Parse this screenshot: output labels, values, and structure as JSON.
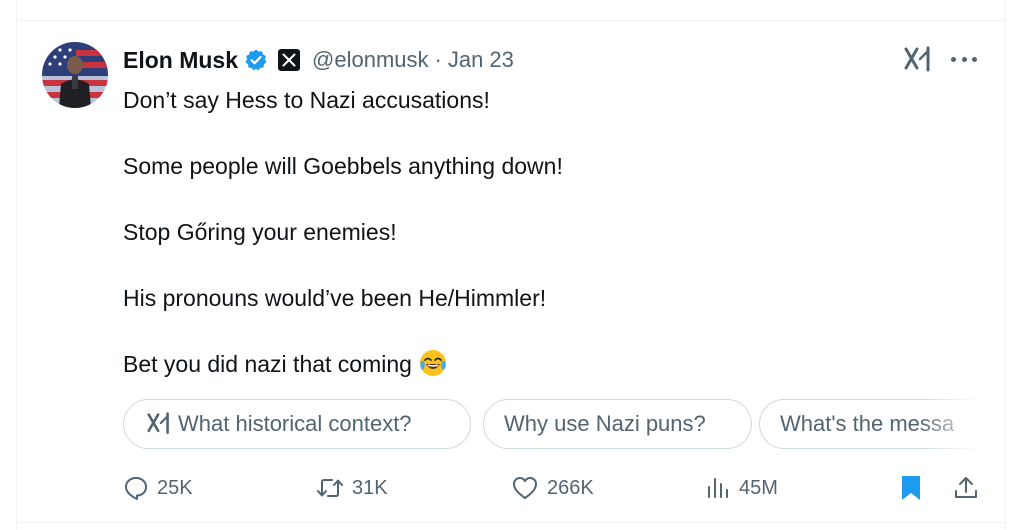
{
  "tweet": {
    "author_name": "Elon Musk",
    "handle": "@elonmusk",
    "separator": "·",
    "date": "Jan 23",
    "lines": [
      "Don’t say Hess to Nazi accusations!",
      "Some people will Goebbels anything down!",
      "Stop Gőring your enemies!",
      "His pronouns would’ve been He/Himmler!",
      "Bet you did nazi that coming"
    ],
    "emoji": "face-with-tears-of-joy"
  },
  "grok_suggestions": [
    "What historical context?",
    "Why use Nazi puns?",
    "What's the messa"
  ],
  "actions": {
    "replies": "25K",
    "reposts": "31K",
    "likes": "266K",
    "views": "45M"
  },
  "icons": {
    "verified": "verified-badge-icon",
    "affiliate": "x-logo-icon",
    "grok": "grok-icon",
    "more": "more-icon",
    "reply": "reply-icon",
    "repost": "repost-icon",
    "like": "heart-icon",
    "views": "views-icon",
    "bookmark": "bookmark-icon",
    "share": "share-icon"
  },
  "colors": {
    "text": "#0f1419",
    "secondary": "#536471",
    "verified": "#1d9bf0",
    "bookmark": "#1d9bf0",
    "border": "#cfd9de"
  }
}
